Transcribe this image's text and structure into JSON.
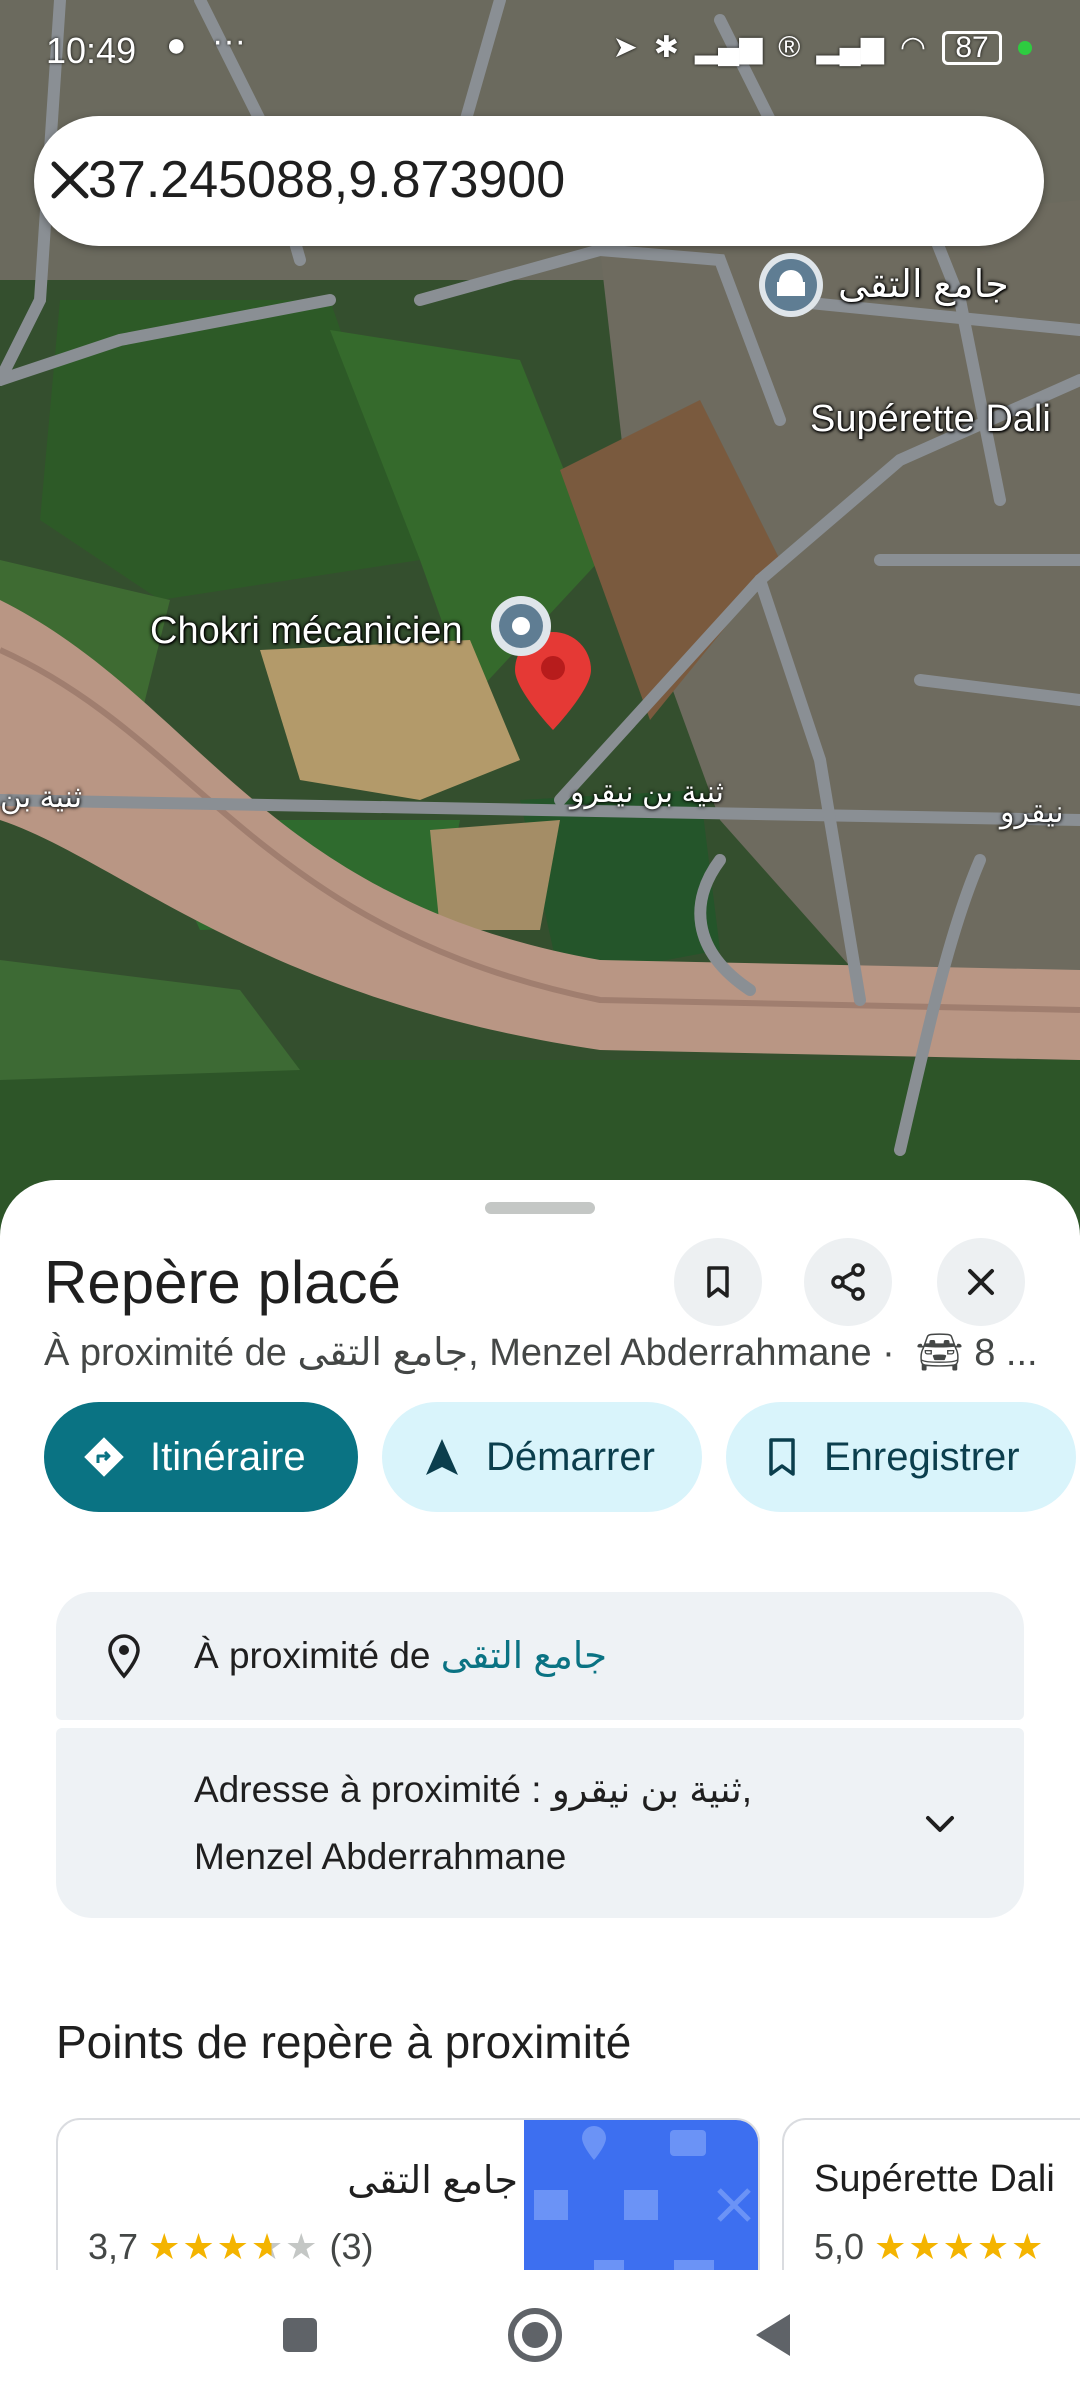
{
  "status_bar": {
    "time": "10:49",
    "extra": "···",
    "battery": "87"
  },
  "search": {
    "query": "37.245088,9.873900"
  },
  "map": {
    "labels": {
      "mosque": "جامع التقى",
      "superette": "Supérette Dali",
      "mechanic": "Chokri mécanicien",
      "road_center": "ثنية بن نيقرو",
      "road_left": "ثنية بن",
      "road_right": "نيقرو"
    },
    "colors": {
      "pin": "#e53935",
      "road": "#8a8f94",
      "poi_marker": "#5f7d93"
    }
  },
  "sheet": {
    "title": "Repère placé",
    "subtitle_prefix": "À proximité de ",
    "subtitle_place": "جامع التقى",
    "subtitle_suffix": ", Menzel Abderrahmane ·",
    "subtitle_drive": "8 ...",
    "actions": {
      "directions": "Itinéraire",
      "start": "Démarrer",
      "save": "Enregistrer"
    },
    "near_prefix": "À proximité de",
    "near_place": "جامع التقى",
    "address_line1": "Adresse à proximité : ثنية بن نيقرو,",
    "address_line2": "Menzel Abderrahmane",
    "section_title": "Points de repère à proximité",
    "poi_cards": [
      {
        "name": "جامع التقى",
        "rating": "3,7",
        "stars": 3.7,
        "count": "(3)"
      },
      {
        "name": "Supérette Dali",
        "rating": "5,0",
        "stars": 5
      }
    ]
  },
  "accent_color": "#0a7383"
}
